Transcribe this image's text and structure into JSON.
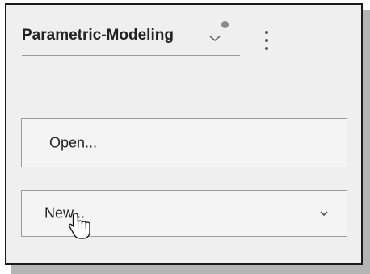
{
  "panel": {
    "title": "Parametric-Modeling",
    "status_dot_color": "#8a8a8a"
  },
  "icons": {
    "title_dropdown": "chevron-down-icon",
    "menu": "kebab-menu-icon",
    "new_dropdown": "chevron-down-icon",
    "cursor": "hand-pointer-icon"
  },
  "buttons": {
    "open_label": "Open...",
    "new_label": "New..."
  }
}
